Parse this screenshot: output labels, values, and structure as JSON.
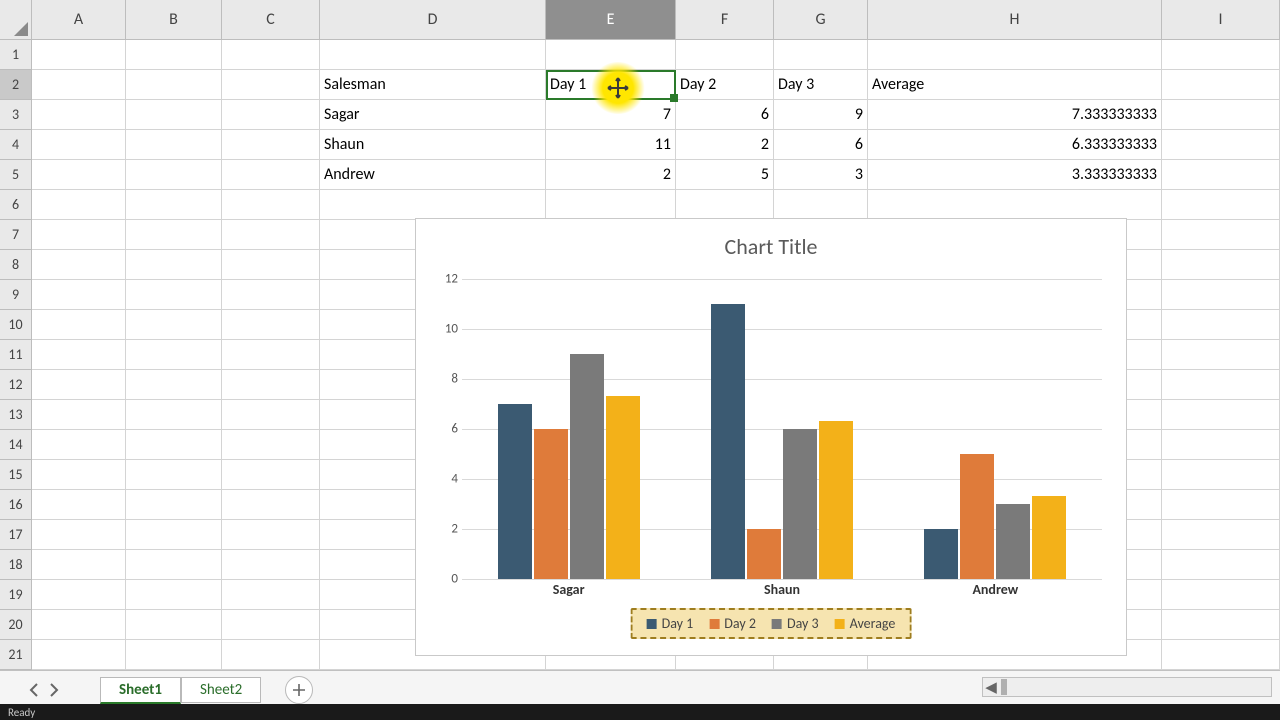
{
  "sheet": {
    "columns": [
      "A",
      "B",
      "C",
      "D",
      "E",
      "F",
      "G",
      "H",
      "I"
    ],
    "row_count": 21,
    "selected_col": "E",
    "selected_row": 2,
    "tabs": [
      "Sheet1",
      "Sheet2"
    ],
    "active_tab": "Sheet1",
    "status": "Ready"
  },
  "table": {
    "headers": {
      "salesman": "Salesman",
      "day1": "Day 1",
      "day2": "Day 2",
      "day3": "Day 3",
      "avg": "Average"
    },
    "rows": [
      {
        "salesman": "Sagar",
        "day1": "7",
        "day2": "6",
        "day3": "9",
        "avg": "7.333333333"
      },
      {
        "salesman": "Shaun",
        "day1": "11",
        "day2": "2",
        "day3": "6",
        "avg": "6.333333333"
      },
      {
        "salesman": "Andrew",
        "day1": "2",
        "day2": "5",
        "day3": "3",
        "avg": "3.333333333"
      }
    ]
  },
  "chart_data": {
    "type": "bar",
    "title": "Chart Title",
    "categories": [
      "Sagar",
      "Shaun",
      "Andrew"
    ],
    "series": [
      {
        "name": "Day 1",
        "values": [
          7,
          11,
          2
        ],
        "color": "#3b5a72"
      },
      {
        "name": "Day 2",
        "values": [
          6,
          2,
          5
        ],
        "color": "#df7b3a"
      },
      {
        "name": "Day 3",
        "values": [
          9,
          6,
          3
        ],
        "color": "#7a7a7a"
      },
      {
        "name": "Average",
        "values": [
          7.333333333,
          6.333333333,
          3.333333333
        ],
        "color": "#f3b119"
      }
    ],
    "xlabel": "",
    "ylabel": "",
    "ylim": [
      0,
      12
    ],
    "yticks": [
      0,
      2,
      4,
      6,
      8,
      10,
      12
    ]
  }
}
